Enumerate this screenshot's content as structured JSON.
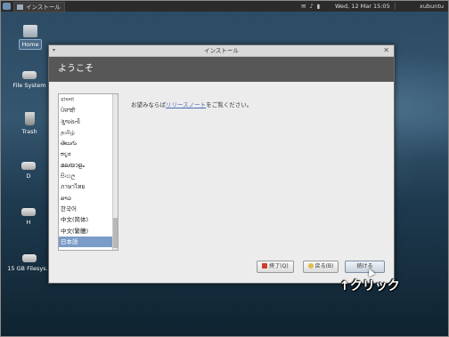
{
  "panel": {
    "task_label": "インストール",
    "clock": "Wed, 12 Mar  15:05",
    "user": "xubuntu"
  },
  "desktop_icons": [
    {
      "label": "Home",
      "icon": "home-folder-icon",
      "selected": true
    },
    {
      "label": "File System",
      "icon": "drive-icon",
      "selected": false
    },
    {
      "label": "Trash",
      "icon": "trash-icon",
      "selected": false
    },
    {
      "label": "D",
      "icon": "drive-icon",
      "selected": false
    },
    {
      "label": "H",
      "icon": "drive-icon",
      "selected": false
    },
    {
      "label": "15 GB Filesys...",
      "icon": "drive-icon",
      "selected": false
    }
  ],
  "window": {
    "title": "インストール",
    "banner": "ようこそ",
    "welcome_prefix": "お望みならば",
    "welcome_link": "リリースノート",
    "welcome_suffix": "をご覧ください。",
    "languages": [
      "বাংলা",
      "ਪੰਜਾਬੀ",
      "ગુજરાતી",
      "தமிழ்",
      "తెలుగు",
      "ಕನ್ನಡ",
      "മലയാളം",
      "සිංහල",
      "ภาษาไทย",
      "ລາວ",
      "한국어",
      "中文(简体)",
      "中文(繁體)",
      "日本語"
    ],
    "selected_language": "日本語",
    "buttons": {
      "quit": "終了(Q)",
      "back": "戻る(B)",
      "next": "続ける"
    }
  },
  "annotation": "↑クリック",
  "colors": {
    "banner": "#575757",
    "selected": "#7a9cc6",
    "link": "#4a6fb4"
  }
}
